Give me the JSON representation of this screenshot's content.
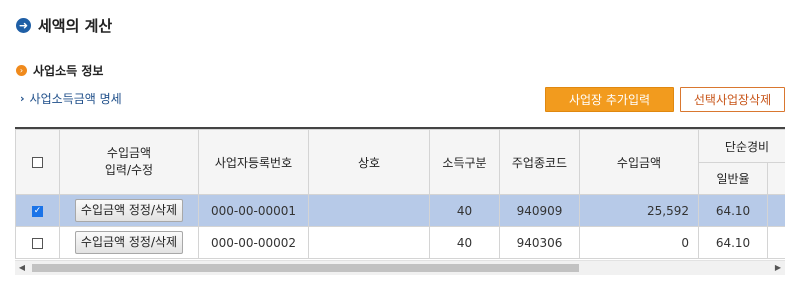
{
  "page_title": "세액의 계산",
  "section_title": "사업소득 정보",
  "sub_link": "사업소득금액 명세",
  "buttons": {
    "add_business": "사업장 추가입력",
    "delete_selected": "선택사업장삭제"
  },
  "table": {
    "headers": {
      "amount_input_line1": "수입금액",
      "amount_input_line2": "입력/수정",
      "business_reg_no": "사업자등록번호",
      "trade_name": "상호",
      "income_type": "소득구분",
      "main_industry_code": "주업종코드",
      "revenue": "수입금액",
      "simple_expense_rate": "단순경비",
      "general_rate": "일반율"
    },
    "rows": [
      {
        "selected": true,
        "edit_button": "수입금액 정정/삭제",
        "business_reg_no": "000-00-00001",
        "trade_name": "",
        "income_type": "40",
        "main_industry_code": "940909",
        "revenue": "25,592",
        "general_rate": "64.10",
        "extra": ""
      },
      {
        "selected": false,
        "edit_button": "수입금액 정정/삭제",
        "business_reg_no": "000-00-00002",
        "trade_name": "",
        "income_type": "40",
        "main_industry_code": "940306",
        "revenue": "0",
        "general_rate": "64.10",
        "extra": ""
      }
    ]
  },
  "icons": {
    "title_icon": "arrow-circle-icon",
    "section_icon": "orange-bullet-icon",
    "link_icon": "chevron-right-icon"
  },
  "colors": {
    "primary_blue": "#1f5fa6",
    "accent_orange": "#f29b1e",
    "selected_row": "#b7cae8"
  }
}
